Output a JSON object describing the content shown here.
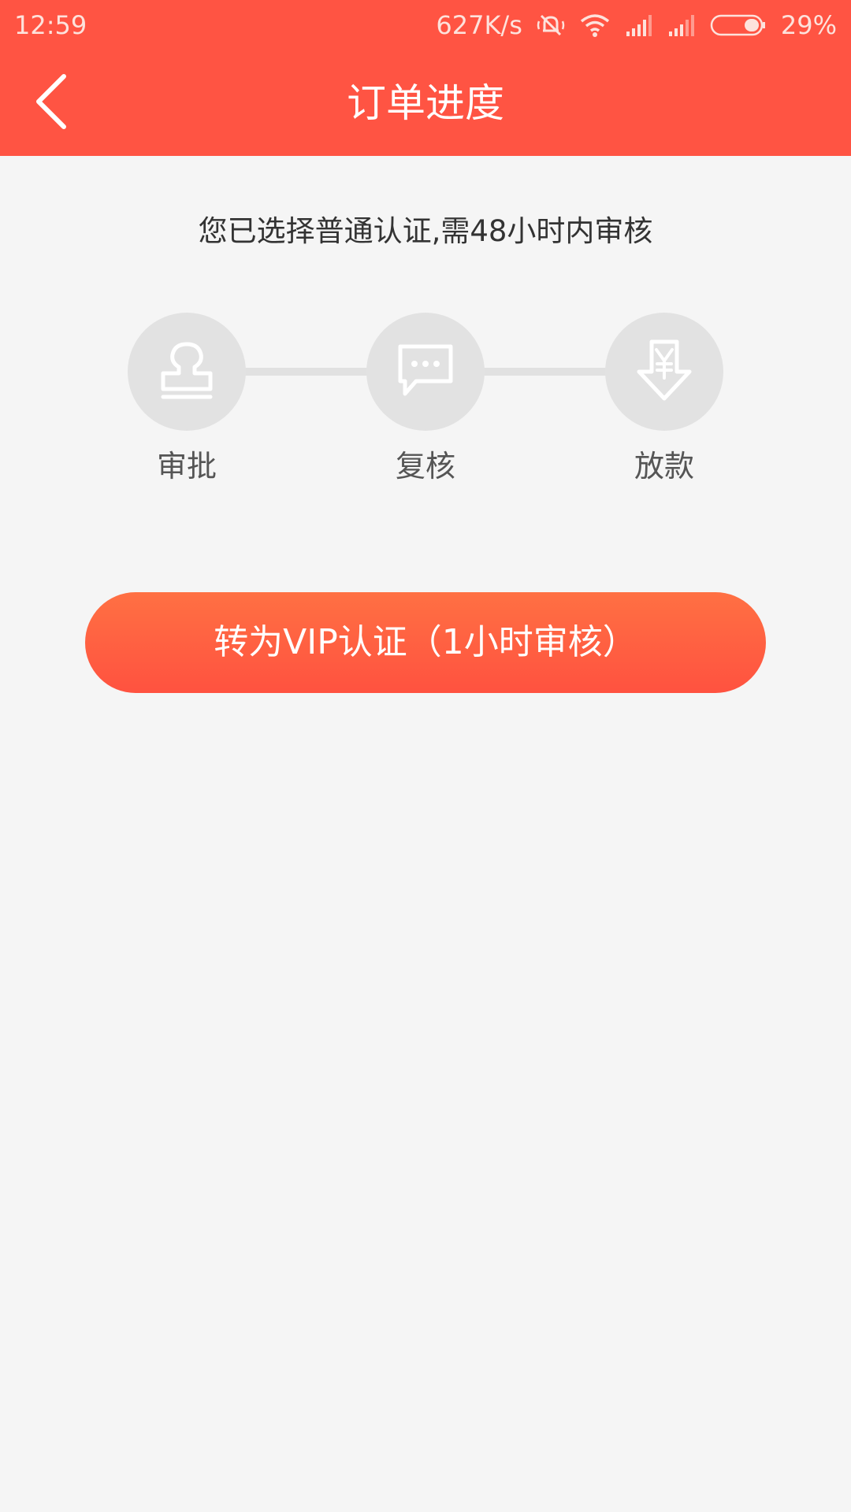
{
  "status_bar": {
    "time": "12:59",
    "network_speed": "627K/s",
    "battery": "29%",
    "icons": [
      "mute-vibrate-icon",
      "wifi-icon",
      "signal-icon",
      "signal-icon",
      "battery-icon"
    ]
  },
  "nav": {
    "title": "订单进度",
    "back_icon": "chevron-left-icon"
  },
  "notice": "您已选择普通认证,需48小时内审核",
  "steps": [
    {
      "label": "审批",
      "icon": "stamp-icon"
    },
    {
      "label": "复核",
      "icon": "chat-bubble-icon"
    },
    {
      "label": "放款",
      "icon": "yuan-download-icon"
    }
  ],
  "vip_button": {
    "label": "转为VIP认证（1小时审核）"
  },
  "colors": {
    "header": "#ff5443",
    "background": "#f5f5f5",
    "button_top": "#ff7043",
    "button_bottom": "#ff5240",
    "step_inactive": "#e2e2e2"
  }
}
